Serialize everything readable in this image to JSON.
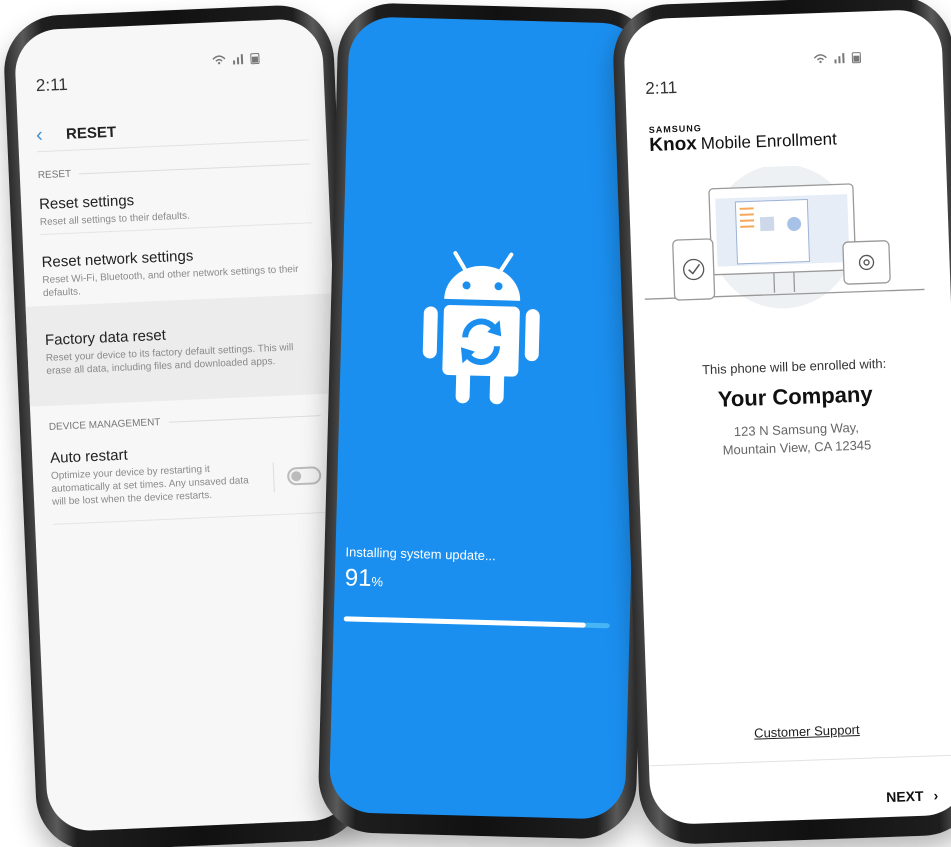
{
  "phone1": {
    "status_time": "2:11",
    "status_icons": "wifi-icon signal-icon battery-icon",
    "header_title": "RESET",
    "section_reset": "RESET",
    "items": [
      {
        "title": "Reset settings",
        "desc": "Reset all settings to their defaults."
      },
      {
        "title": "Reset network settings",
        "desc": "Reset Wi-Fi, Bluetooth, and other network settings to their defaults."
      },
      {
        "title": "Factory data reset",
        "desc": "Reset your device to its factory default settings. This will erase all data, including files and downloaded apps."
      }
    ],
    "section_device": "DEVICE MANAGEMENT",
    "auto_restart": {
      "title": "Auto restart",
      "desc": "Optimize your device by restarting it automatically at set times. Any unsaved data will be lost when the device restarts.",
      "enabled": false
    }
  },
  "phone2": {
    "background": "#1b8ff0",
    "install_label": "Installing system update...",
    "progress_value": "91",
    "progress_unit": "%",
    "progress_fraction": 0.91
  },
  "phone3": {
    "status_time": "2:11",
    "brand_small": "SAMSUNG",
    "brand_knox": "Knox",
    "brand_title": "Mobile Enrollment",
    "enroll_text": "This phone will be enrolled with:",
    "company": "Your Company",
    "address_line1": "123 N Samsung Way,",
    "address_line2": "Mountain View, CA 12345",
    "support_link": "Customer Support",
    "next_label": "NEXT",
    "next_icon": "chevron-right-icon"
  }
}
